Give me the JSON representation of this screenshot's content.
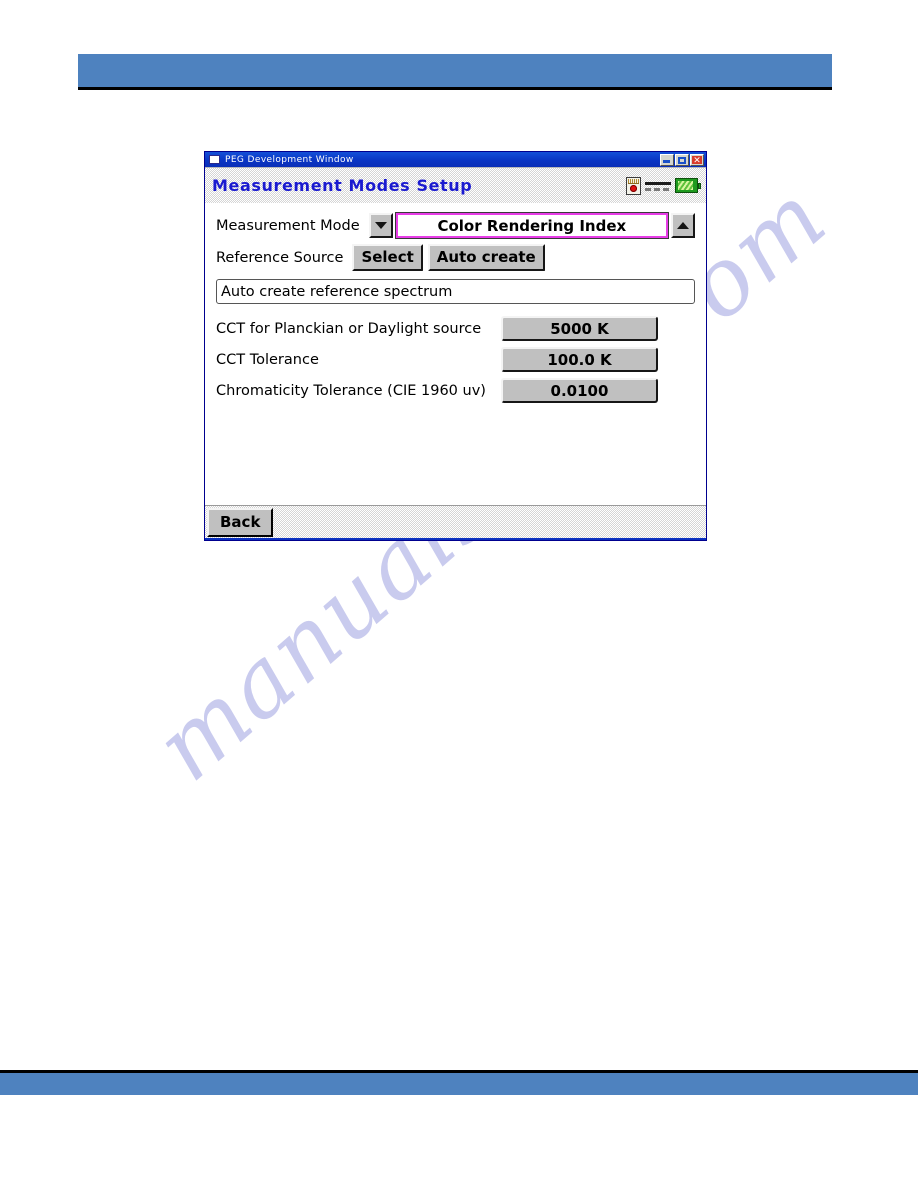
{
  "page": {
    "watermark_text": "manualshive.com",
    "header_band_color": "#4e82bf",
    "footer_band_color": "#4e82bf"
  },
  "window": {
    "title": "PEG Development Window",
    "app_icon": "window-icon",
    "controls": {
      "minimize": "minimize-icon",
      "maximize": "maximize-icon",
      "close_glyph": "✕"
    }
  },
  "screen": {
    "title": "Measurement Modes Setup",
    "status_icons": [
      {
        "name": "memory-card-icon",
        "state": "record-stopped"
      },
      {
        "name": "connection-icon",
        "state": "dashed-lines"
      },
      {
        "name": "battery-icon",
        "state": "charged"
      }
    ],
    "measurement_mode": {
      "label": "Measurement Mode",
      "value": "Color Rendering Index",
      "prev_icon": "▼",
      "next_icon": "▲",
      "highlight_color": "#e83ce8"
    },
    "reference_source": {
      "label": "Reference Source",
      "select_label": "Select",
      "auto_create_label": "Auto create"
    },
    "spectrum_field": {
      "value": "Auto create reference spectrum",
      "placeholder": "Auto create reference spectrum"
    },
    "parameters": [
      {
        "label": "CCT for Planckian or Daylight source",
        "value": "5000 K"
      },
      {
        "label": "CCT Tolerance",
        "value": "100.0 K"
      },
      {
        "label": "Chromaticity Tolerance (CIE 1960 uv)",
        "value": "0.0100"
      }
    ],
    "footer": {
      "back_label": "Back"
    }
  }
}
